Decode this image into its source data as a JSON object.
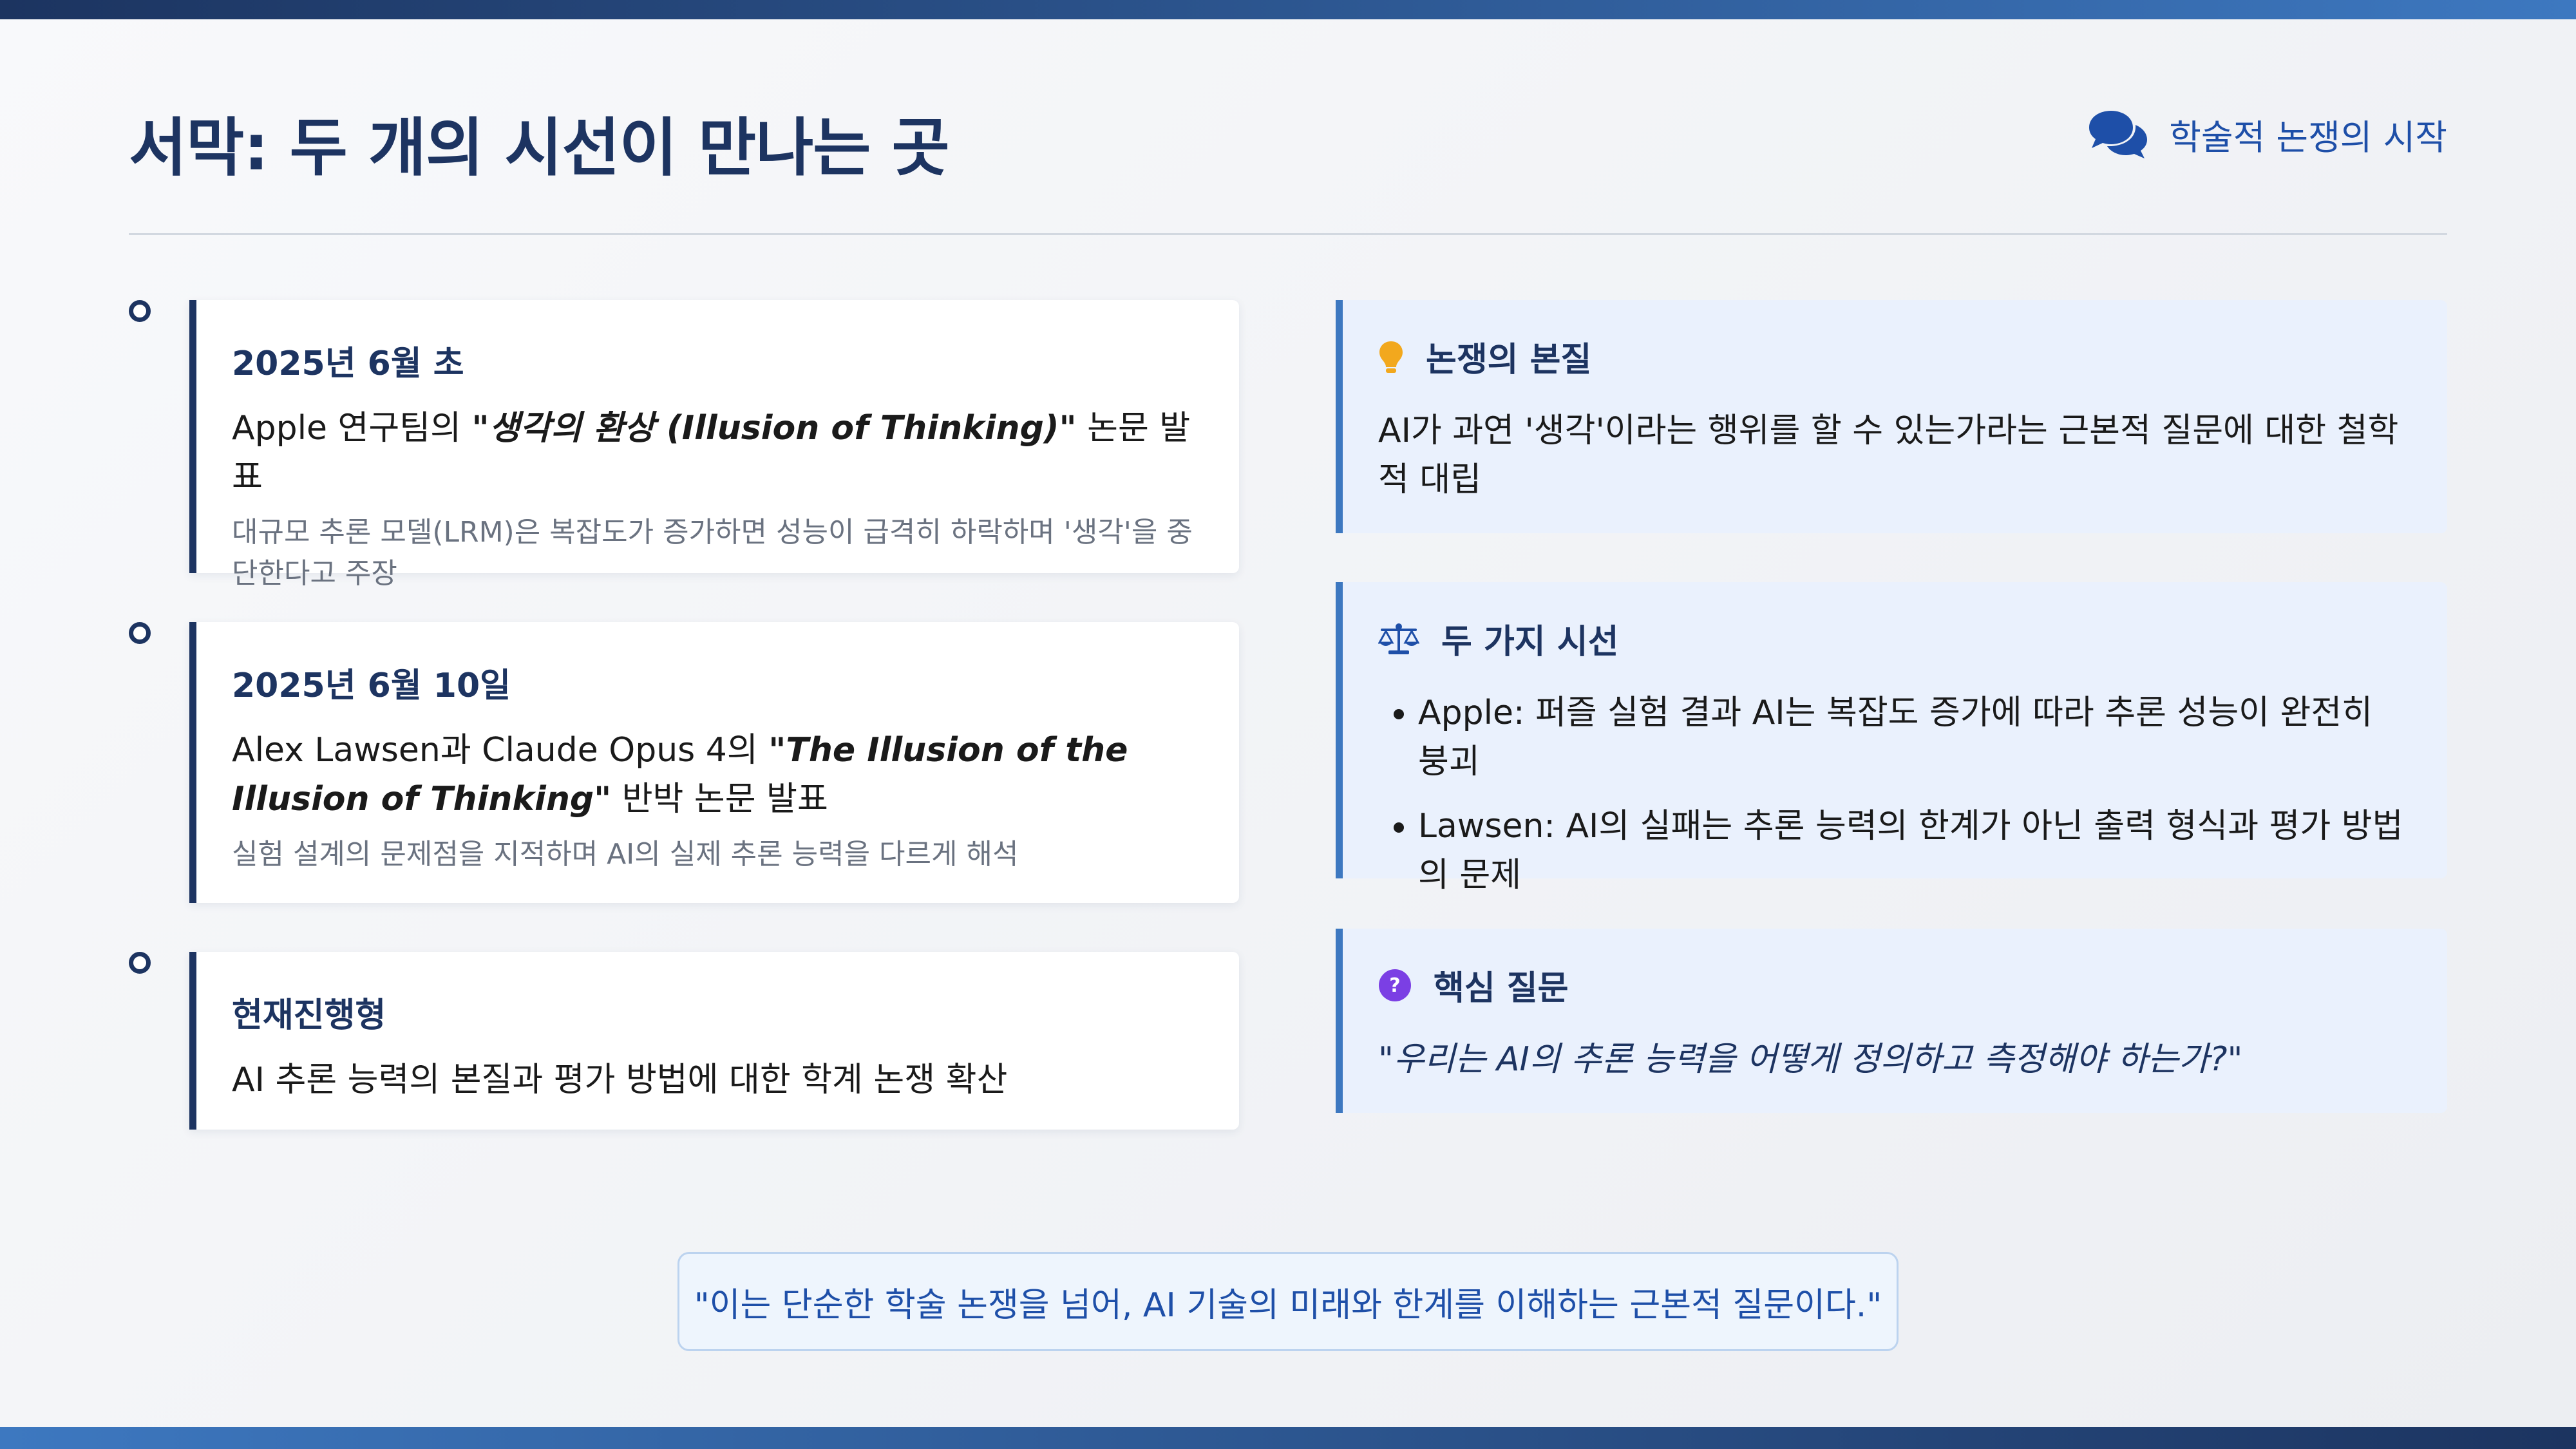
{
  "header": {
    "title": "서막: 두 개의 시선이 만나는 곳",
    "tag_label": "학술적 논쟁의 시작",
    "tag_icon": "comments-icon"
  },
  "timeline": [
    {
      "date": "2025년 6월 초",
      "main_prefix": "Apple 연구팀의 ",
      "main_emphasis": "\"생각의 환상 (Illusion of Thinking)\"",
      "main_suffix": " 논문 발표",
      "detail": "대규모 추론 모델(LRM)은 복잡도가 증가하면 성능이 급격히 하락하며 '생각'을 중단한다고 주장"
    },
    {
      "date": "2025년 6월 10일",
      "main_prefix": "Alex Lawsen과 Claude Opus 4의 ",
      "main_emphasis": "\"The Illusion of the Illusion of Thinking\"",
      "main_suffix": " 반박 논문 발표",
      "detail": "실험 설계의 문제점을 지적하며 AI의 실제 추론 능력을 다르게 해석"
    },
    {
      "date": "현재진행형",
      "main_prefix": "AI 추론 능력의 본질과 평가 방법에 대한 학계 논쟁 확산"
    }
  ],
  "panels": {
    "essence": {
      "icon": "lightbulb-icon",
      "title": "논쟁의 본질",
      "text": "AI가 과연 '생각'이라는 행위를 할 수 있는가라는 근본적 질문에 대한 철학적 대립"
    },
    "perspectives": {
      "icon": "balance-scale-icon",
      "title": "두 가지 시선",
      "items": [
        "Apple: 퍼즐 실험 결과 AI는 복잡도 증가에 따라 추론 성능이 완전히 붕괴",
        "Lawsen: AI의 실패는 추론 능력의 한계가 아닌 출력 형식과 평가 방법의 문제"
      ]
    },
    "question": {
      "icon": "question-circle-icon",
      "title": "핵심 질문",
      "quote": "\"우리는 AI의 추론 능력을 어떻게 정의하고 측정해야 하는가?\""
    }
  },
  "footer_quote": "\"이는 단순한 학술 논쟁을 넘어, AI 기술의 미래와 한계를 이해하는 근본적 질문이다.\"",
  "colors": {
    "navy": "#1d3461",
    "accent_blue": "#3d78c0",
    "link_blue": "#1e4fa8",
    "panel_bg": "#eaf1fd",
    "bulb_orange": "#f2a81d",
    "question_purple": "#7b3fe4"
  }
}
